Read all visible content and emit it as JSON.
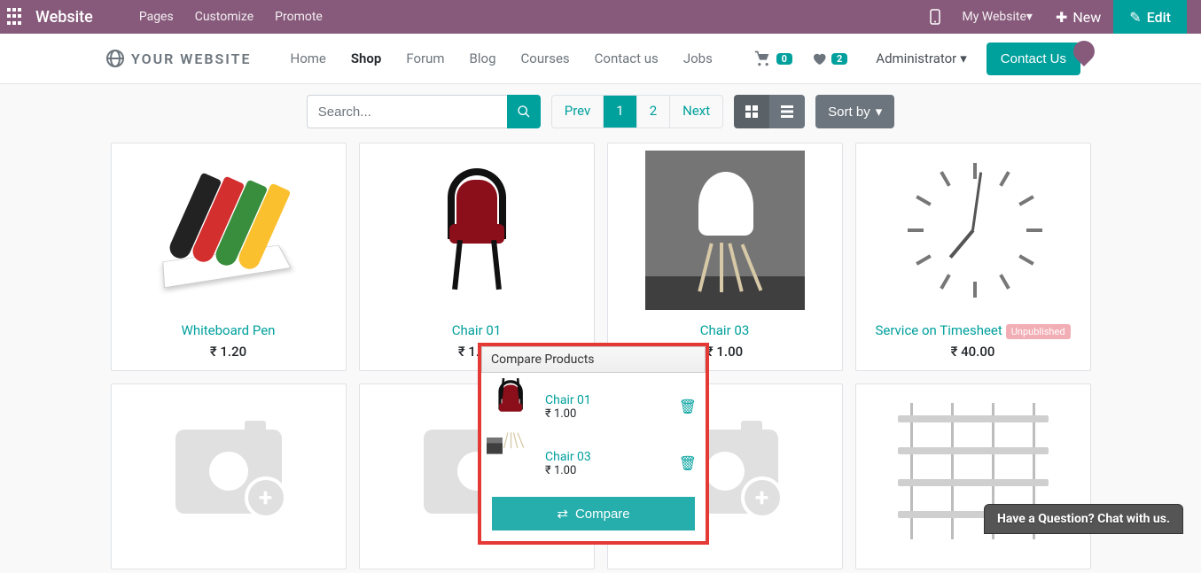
{
  "topbar": {
    "brand": "Website",
    "links": {
      "pages": "Pages",
      "customize": "Customize",
      "promote": "Promote"
    },
    "my_website": "My Website",
    "new": "New",
    "edit": "Edit"
  },
  "header": {
    "site_name": "YOUR WEBSITE",
    "nav": {
      "home": "Home",
      "shop": "Shop",
      "forum": "Forum",
      "blog": "Blog",
      "courses": "Courses",
      "contact": "Contact us",
      "jobs": "Jobs"
    },
    "cart_count": "0",
    "wishlist_count": "2",
    "admin": "Administrator",
    "contact_btn": "Contact Us"
  },
  "controls": {
    "search_placeholder": "Search...",
    "prev": "Prev",
    "page1": "1",
    "page2": "2",
    "next": "Next",
    "sort": "Sort by"
  },
  "products": [
    {
      "name": "Whiteboard Pen",
      "price": "₹ 1.20",
      "image": "pens"
    },
    {
      "name": "Chair 01",
      "price": "₹ 1.00",
      "image": "chair-red"
    },
    {
      "name": "Chair 03",
      "price": "₹ 1.00",
      "image": "chair-white"
    },
    {
      "name": "Service on Timesheet",
      "price": "₹ 40.00",
      "image": "clock",
      "unpublished": "Unpublished"
    }
  ],
  "products_row2": [
    {
      "image": "placeholder"
    },
    {
      "image": "placeholder"
    },
    {
      "image": "placeholder"
    },
    {
      "image": "shelf"
    }
  ],
  "compare": {
    "title": "Compare Products",
    "items": [
      {
        "name": "Chair 01",
        "price": "₹ 1.00",
        "image": "chair-red"
      },
      {
        "name": "Chair 03",
        "price": "₹ 1.00",
        "image": "chair-white"
      }
    ],
    "button": "Compare"
  },
  "chat": {
    "text": "Have a Question? Chat with us."
  }
}
